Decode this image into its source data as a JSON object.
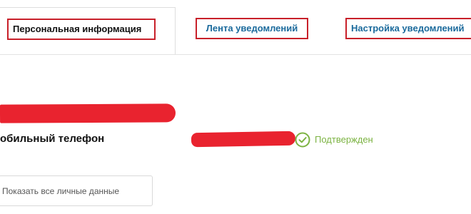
{
  "tabs": [
    {
      "label": "Персональная информация",
      "active": true
    },
    {
      "label": "Лента уведомлений",
      "active": false
    },
    {
      "label": "Настройка уведомлений",
      "active": false
    }
  ],
  "phone": {
    "label": "обильный телефон",
    "status": "Подтвержден",
    "status_icon": "check-circle-icon"
  },
  "actions": {
    "show_all_label": "Показать все личные данные"
  },
  "colors": {
    "tab_outline": "#c8202a",
    "link": "#1b6a9c",
    "confirmed": "#7cb342",
    "redaction": "#e9232f"
  }
}
